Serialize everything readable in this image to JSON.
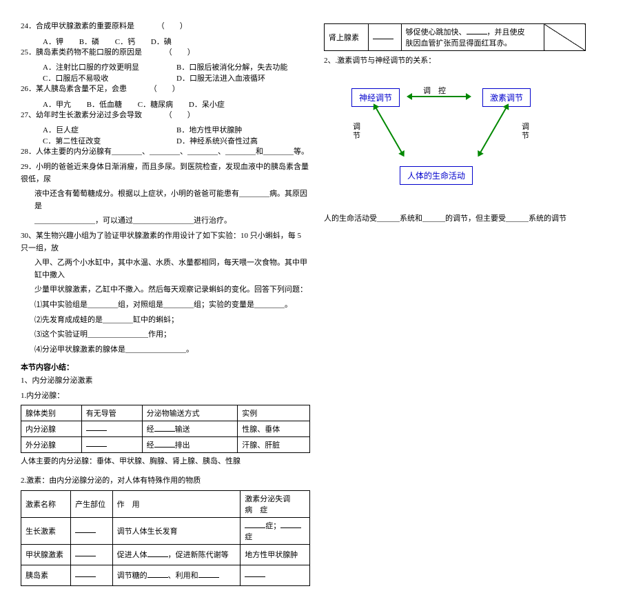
{
  "leftCol": {
    "q24": "24．合成甲状腺激素的重要原料是",
    "q24paren": "（　　）",
    "q24opts": [
      "A．钾",
      "B．磷",
      "C．钙",
      "D．碘"
    ],
    "q25": "25．胰岛素类药物不能口服的原因是",
    "q25paren": "（　　）",
    "q25a": "A．注射比口服的疗效更明显",
    "q25b": "B．口服后被消化分解，失去功能",
    "q25c": "C．口服后不易吸收",
    "q25d": "D．口服无法进入血液循环",
    "q26": "26．某人胰岛素含量不足，会患",
    "q26paren": "（　　）",
    "q26opts": [
      "A．甲亢",
      "B．低血糖",
      "C．糖尿病",
      "D．呆小症"
    ],
    "q27": "27、幼年时生长激素分泌过多会导致",
    "q27paren": "（　　）",
    "q27a": "A．巨人症",
    "q27b": "B．地方性甲状腺肿",
    "q27c": "C．第二性征改变",
    "q27d": "D．神经系统兴奋性过高",
    "q28": "28．人体主要的内分泌腺有________、________、________、________和________等。",
    "q29a": "29．小明的爸爸近来身体日渐消瘦，而且多尿。到医院检查，发现血液中的胰岛素含量很低，尿",
    "q29b": "液中还含有葡萄糖成分。根据以上症状，小明的爸爸可能患有________病。其原因是",
    "q29c": "________________，可以通过________________进行治疗。",
    "q30a": "30、某生物兴趣小组为了验证甲状腺激素的作用设计了如下实验：10 只小蝌蚪，每 5 只一组，放",
    "q30b": "入甲、乙两个小水缸中，其中水温、水质、水量都相同，每天喂一次食物。其中甲缸中撒入",
    "q30c": "少量甲状腺激素，乙缸中不撒入。然后每天观察记录蝌蚪的变化。回答下列问题：",
    "q30_1": "⑴其中实验组是________组，对照组是________组；实验的变量是________。",
    "q30_2": "⑵先发育成成蛙的是________缸中的蝌蚪；",
    "q30_3": "⑶这个实验证明________________作用；",
    "q30_4": "⑷分泌甲状腺激素的腺体是________________。",
    "sectionTitle": "本节内容小结：",
    "sec1": "1、内分泌腺分泌激素",
    "sec1_1": "1.内分泌腺：",
    "t1": {
      "h1": "腺体类别",
      "h2": "有无导管",
      "h3": "分泌物输送方式",
      "h4": "实例",
      "r1c1": "内分泌腺",
      "r1c3a": "经",
      "r1c3b": "输送",
      "r1c4": "性腺、垂体",
      "r2c1": "外分泌腺",
      "r2c3a": "经",
      "r2c3b": "排出",
      "r2c4": "汗腺、肝脏"
    },
    "noteAfterT1": "人体主要的内分泌腺：垂体、甲状腺、胸腺、肾上腺、胰岛、性腺",
    "sec2": "2.激素：由内分泌腺分泌的，对人体有特殊作用的物质",
    "t2": {
      "h1": "激素名称",
      "h2": "产生部位",
      "h3": "作　用",
      "h4a": "激素分泌失调",
      "h4b": "病　症",
      "r1c1": "生长激素",
      "r1c3": "调节人体生长发育",
      "r1c4a": "症；",
      "r1c4b": "症",
      "r2c1": "甲状腺激素",
      "r2c3a": "促进人体",
      "r2c3b": "，促进新陈代谢等",
      "r2c4": "地方性甲状腺肿",
      "r3c1": "胰岛素",
      "r3c3a": "调节糖的",
      "r3c3b": "、利用和"
    }
  },
  "rightCol": {
    "tableRight": {
      "r1c1": "肾上腺素",
      "r1c2a": "够促使心跳加快、",
      "r1c2b": "，并且使皮",
      "r1c2c": "肤因血管扩张而显得面红耳赤。"
    },
    "section2": "2、.激素调节与神经调节的关系：",
    "diagram": {
      "boxTL": "神经调节",
      "boxTR": "激素调节",
      "boxB": "人体的生命活动",
      "labelTop": "调　控",
      "labelL1": "调",
      "labelL2": "节",
      "labelR1": "调",
      "labelR2": "节"
    },
    "summary": "人的生命活动受______系统和______的调节，但主要受______系统的调节"
  }
}
